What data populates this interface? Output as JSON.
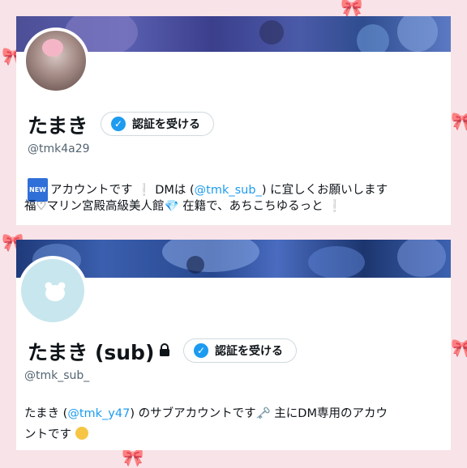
{
  "profiles": [
    {
      "name": "たまき",
      "verify_label": "認証を受ける",
      "handle": "@tmk4a29",
      "bio_line1": {
        "prefix": "アカウントです",
        "mid": " DMは (",
        "link": "@tmk_sub_",
        "suffix": ") に宜しくお願いします"
      },
      "bio_line2": {
        "prefix": "福♡マリン宮殿高級美人館",
        "suffix": " 在籍で、あちこちゆるっと"
      },
      "icons": [
        "new-icon",
        "exclamation-icon",
        "gem-icon"
      ]
    },
    {
      "name": "たまき (sub)",
      "verify_label": "認証を受ける",
      "handle": "@tmk_sub_",
      "bio_line1": {
        "prefix": "たまき (",
        "link": "@tmk_y47",
        "suffix": ") のサブアカウントです",
        "after_key": " 主にDM専用のアカウ"
      },
      "bio_line2": {
        "text": "ントです"
      },
      "icons": [
        "lock-icon",
        "key-icon",
        "pensive-face-icon"
      ]
    }
  ],
  "colors": {
    "link": "#1d9bf0",
    "verified_badge": "#1d9bf0",
    "background": "#f7e3e8"
  }
}
